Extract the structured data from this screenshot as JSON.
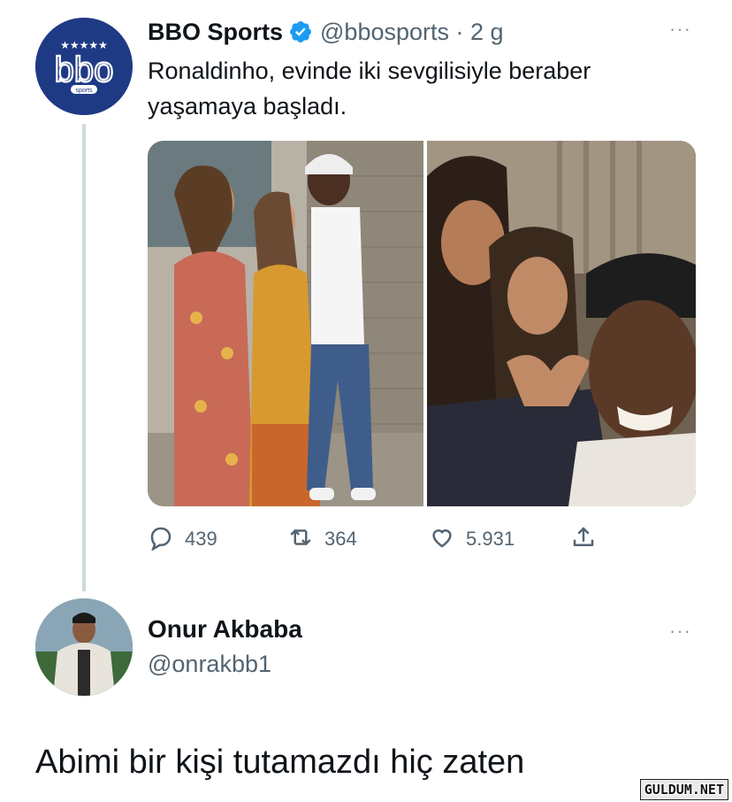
{
  "tweet": {
    "author_name": "BBO Sports",
    "handle_time": "@bbosports · 2 g",
    "text": "Ronaldinho, evinde iki sevgilisiyle beraber yaşamaya başladı.",
    "more": "···",
    "avatar_logo": "bbo",
    "avatar_sub": "sports",
    "avatar_stars": "★★★★★",
    "actions": {
      "reply_icon": "reply-icon",
      "replies": "439",
      "retweet_icon": "retweet-icon",
      "retweets": "364",
      "like_icon": "heart-icon",
      "likes": "5.931",
      "share_icon": "share-icon"
    }
  },
  "reply": {
    "author_name": "Onur Akbaba",
    "handle": "@onrakbb1",
    "more": "···",
    "text": "Abimi bir kişi tutamazdı hiç zaten"
  },
  "watermark": "GULDUM.NET",
  "colors": {
    "verified": "#1d9bf0",
    "secondary_text": "#536471",
    "thread_line": "#cfd9de",
    "avatar_bg": "#1f3a84"
  }
}
